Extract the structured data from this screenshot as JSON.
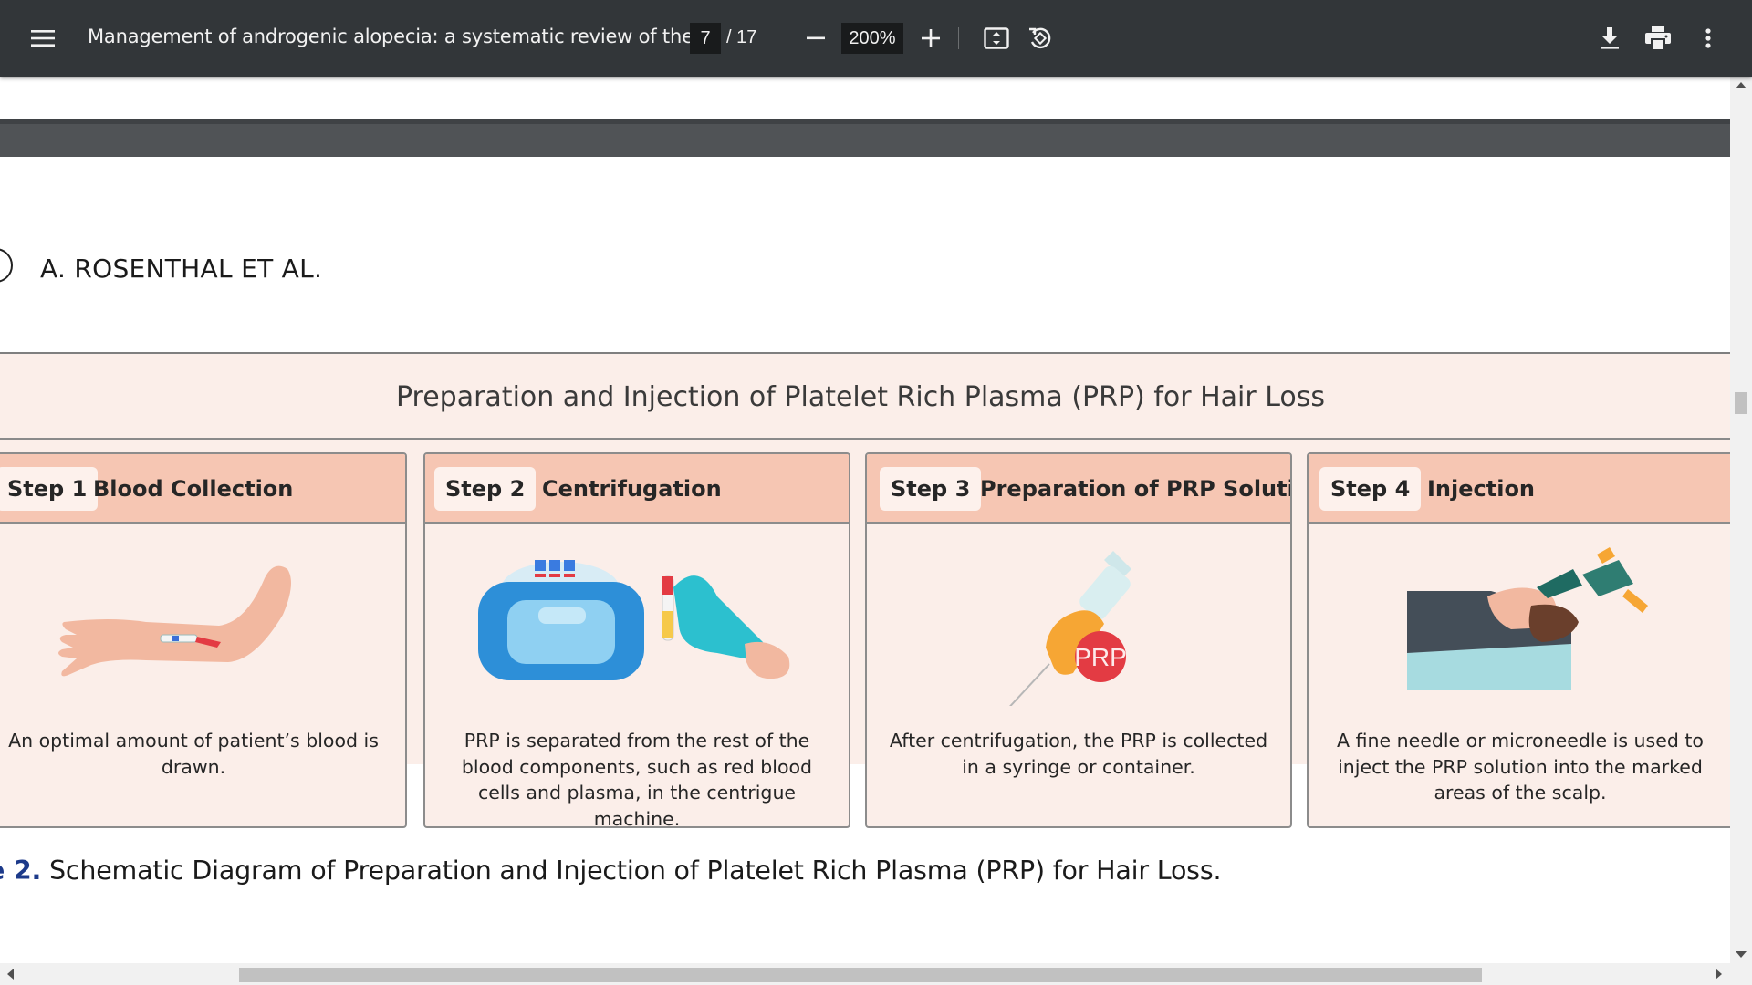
{
  "toolbar": {
    "title": "Management of androgenic alopecia: a systematic review of the ...",
    "page_current": "7",
    "page_total": "/ 17",
    "zoom": "200%",
    "icons": [
      "menu-icon",
      "zoom-out-icon",
      "zoom-in-icon",
      "fit-page-icon",
      "rotate-icon",
      "download-icon",
      "print-icon",
      "more-vert-icon"
    ]
  },
  "page": {
    "running_head": "A. ROSENTHAL ET AL.",
    "figure_title": "Preparation and Injection of Platelet Rich Plasma (PRP) for Hair Loss",
    "steps": [
      {
        "tag": "Step 1",
        "name": "Blood Collection",
        "description": "An optimal amount of patient’s blood is drawn."
      },
      {
        "tag": "Step 2",
        "name": "Centrifugation",
        "description": "PRP is separated from the rest of the blood components, such as red blood cells and plasma, in the centrigue machine."
      },
      {
        "tag": "Step 3",
        "name": "Preparation of PRP Solution",
        "description": "After centrifugation, the PRP is collected in a syringe or container."
      },
      {
        "tag": "Step 4",
        "name": "Injection",
        "description": "A fine needle or microneedle is used to inject the PRP solution into the marked areas of the scalp."
      }
    ],
    "prp_label": "PRP",
    "caption_label": "e 2.",
    "caption_text": " Schematic Diagram of Preparation and Injection of Platelet Rich Plasma (PRP) for Hair Loss."
  },
  "colors": {
    "toolbar_bg": "#323639",
    "figure_bg": "#fbeee9",
    "step_header": "#f6c6b3",
    "caption_label": "#1d3a8a"
  }
}
